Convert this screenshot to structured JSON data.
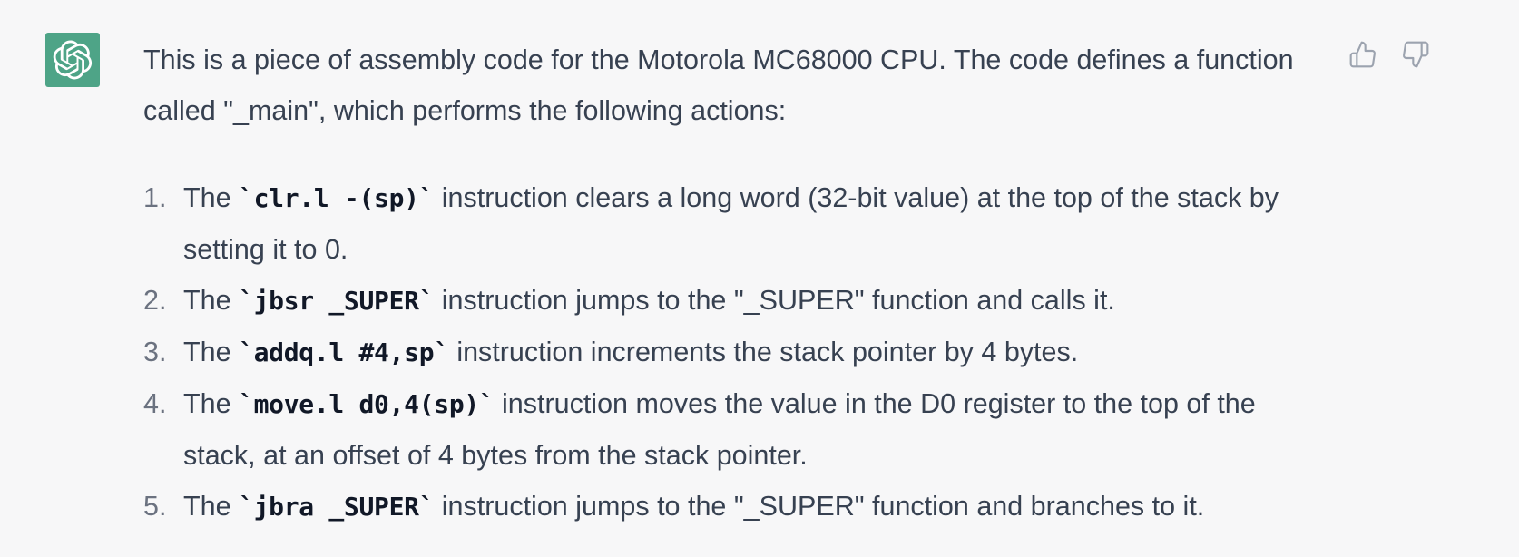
{
  "message": {
    "intro": "This is a piece of assembly code for the Motorola MC68000 CPU. The code defines a function called \"_main\", which performs the following actions:",
    "items": [
      {
        "number": "1.",
        "before": "The ",
        "code": "`clr.l -(sp)`",
        "after": " instruction clears a long word (32-bit value) at the top of the stack by setting it to 0."
      },
      {
        "number": "2.",
        "before": "The ",
        "code": "`jbsr _SUPER`",
        "after": " instruction jumps to the \"_SUPER\" function and calls it."
      },
      {
        "number": "3.",
        "before": "The ",
        "code": "`addq.l #4,sp`",
        "after": " instruction increments the stack pointer by 4 bytes."
      },
      {
        "number": "4.",
        "before": "The ",
        "code": "`move.l d0,4(sp)`",
        "after": " instruction moves the value in the D0 register to the top of the stack, at an offset of 4 bytes from the stack pointer."
      },
      {
        "number": "5.",
        "before": "The ",
        "code": "`jbra _SUPER`",
        "after": " instruction jumps to the \"_SUPER\" function and branches to it."
      }
    ]
  },
  "icons": {
    "avatar": "openai-logo-icon",
    "like": "thumbs-up-icon",
    "dislike": "thumbs-down-icon"
  },
  "colors": {
    "background": "#f7f7f8",
    "avatar_bg": "#4ea487",
    "text": "#374151",
    "icon": "#9ca3af"
  }
}
